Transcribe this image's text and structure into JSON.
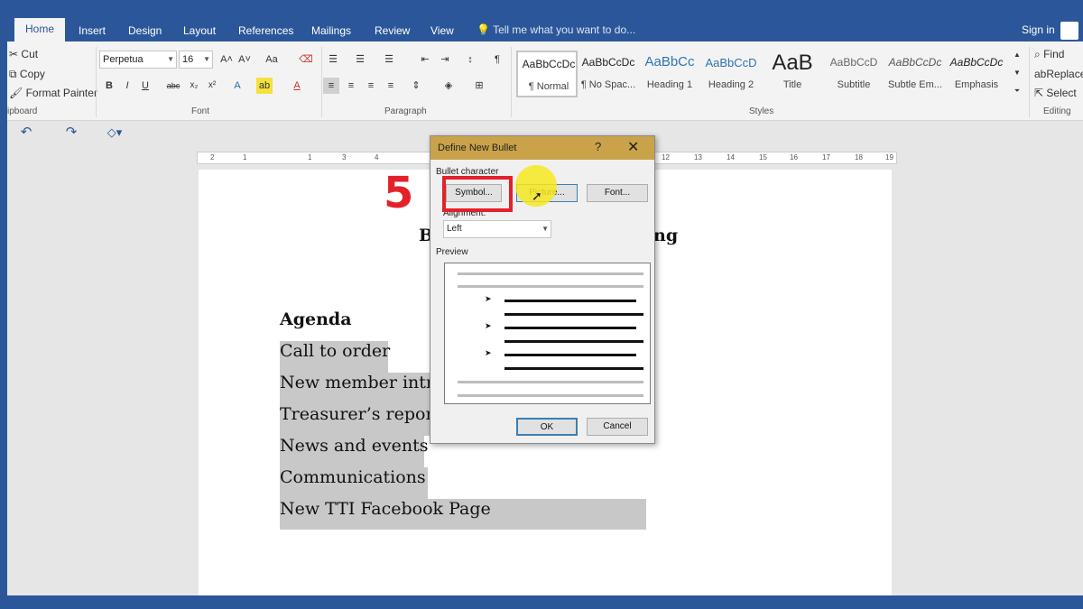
{
  "tabs": [
    {
      "label": "Home",
      "active": true
    },
    {
      "label": "Insert"
    },
    {
      "label": "Design"
    },
    {
      "label": "Layout"
    },
    {
      "label": "References"
    },
    {
      "label": "Mailings"
    },
    {
      "label": "Review"
    },
    {
      "label": "View"
    }
  ],
  "tell_me": "Tell me what you want to do...",
  "sign_in": "Sign in",
  "clipboard": {
    "cut": "Cut",
    "copy": "Copy",
    "format_painter": "Format Painter",
    "label": "ipboard"
  },
  "font": {
    "name": "Perpetua",
    "size": "16",
    "label": "Font",
    "bold": "B",
    "italic": "I",
    "underline": "U",
    "strike": "abc",
    "sub": "x₂",
    "sup": "x²",
    "grow": "A^",
    "shrink": "Aˇ",
    "case": "Aa"
  },
  "paragraph": {
    "label": "Paragraph"
  },
  "styles": {
    "label": "Styles",
    "items": [
      {
        "preview": "AaBbCcDc",
        "name": "¶ Normal"
      },
      {
        "preview": "AaBbCcDc",
        "name": "¶ No Spac..."
      },
      {
        "preview": "AaBbCc",
        "name": "Heading 1"
      },
      {
        "preview": "AaBbCcD",
        "name": "Heading 2"
      },
      {
        "preview": "AaB",
        "name": "Title"
      },
      {
        "preview": "AaBbCcD",
        "name": "Subtitle"
      },
      {
        "preview": "AaBbCcDc",
        "name": "Subtle Em..."
      },
      {
        "preview": "AaBbCcDc",
        "name": "Emphasis"
      }
    ]
  },
  "editing": {
    "find": "Find",
    "replace": "Replace",
    "select": "Select",
    "label": "Editing"
  },
  "ruler": {
    "left_ticks": [
      "2",
      "1",
      "1"
    ],
    "right_ticks": [
      "3",
      "4",
      "12",
      "13",
      "14",
      "15",
      "16",
      "17",
      "18",
      "19"
    ]
  },
  "document": {
    "heading_left": "B",
    "heading_right": "ng",
    "agenda": "Agenda",
    "items": [
      "Call to order",
      "New member intro",
      "Treasurer’s report",
      "News and events",
      "Communications",
      "New TTI Facebook Page"
    ]
  },
  "dialog": {
    "title": "Define New Bullet",
    "help": "?",
    "close": "✕",
    "bullet_character_label": "Bullet character",
    "symbol_button": "Symbol...",
    "picture_button": "Picture...",
    "font_button": "Font...",
    "alignment_label": "Alignment:",
    "alignment_value": "Left",
    "preview_label": "Preview",
    "preview_bullet": "➤",
    "ok_button": "OK",
    "cancel_button": "Cancel"
  },
  "annotation": {
    "step": "5"
  }
}
